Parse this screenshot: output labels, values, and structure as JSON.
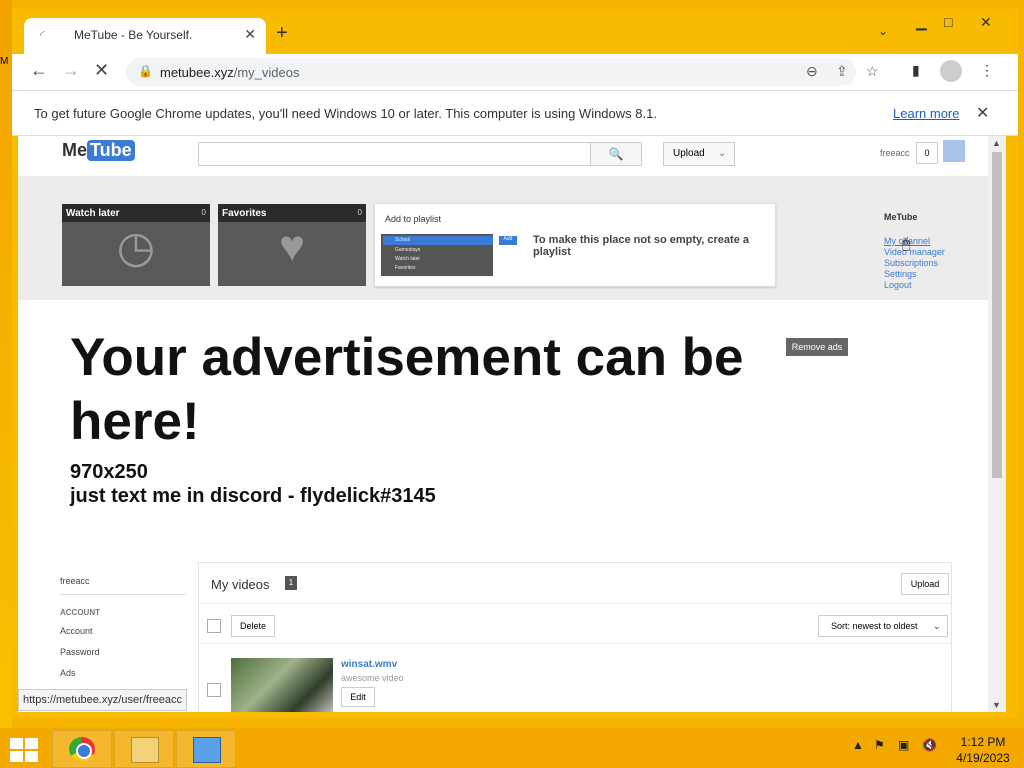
{
  "desktop": {
    "edge_label": "M"
  },
  "browser": {
    "tab_title": "MeTube - Be Yourself.",
    "url_host": "metubee.xyz",
    "url_path": "/my_videos",
    "info_message": "To get future Google Chrome updates, you'll need Windows 10 or later. This computer is using Windows 8.1.",
    "info_link": "Learn more",
    "status_url": "https://metubee.xyz/user/freeacc"
  },
  "site": {
    "logo_me": "Me",
    "logo_tube": "Tube",
    "upload": "Upload",
    "account_name": "freeacc",
    "notifications": "0",
    "cards": [
      {
        "title": "Watch later",
        "count": "0",
        "icon": "clock-icon"
      },
      {
        "title": "Favorites",
        "count": "0",
        "icon": "heart-icon"
      }
    ],
    "playlist": {
      "title": "Add to playlist",
      "mini_items": [
        "School",
        "Gamestays",
        "Watch later",
        "Favorites"
      ],
      "mini_add": "Add",
      "message": "To make this place not so empty, create a playlist"
    },
    "side_menu": {
      "heading": "MeTube",
      "items": [
        "My channel",
        "Video manager",
        "Subscriptions",
        "Settings",
        "Logout"
      ]
    },
    "ad": {
      "headline": "Your advertisement can be here!",
      "size": "970x250",
      "contact": "just text me in discord - flydelick#3145",
      "remove": "Remove ads"
    },
    "left_nav": {
      "user": "freeacc",
      "section": "ACCOUNT",
      "items": [
        "Account",
        "Password",
        "Ads"
      ]
    },
    "videos": {
      "title": "My videos",
      "count": "1",
      "upload": "Upload",
      "delete": "Delete",
      "sort": "Sort: newest to oldest",
      "items": [
        {
          "name": "winsat.wmv",
          "description": "awesome video",
          "edit": "Edit"
        }
      ]
    }
  },
  "taskbar": {
    "time": "1:12 PM",
    "date": "4/19/2023"
  }
}
